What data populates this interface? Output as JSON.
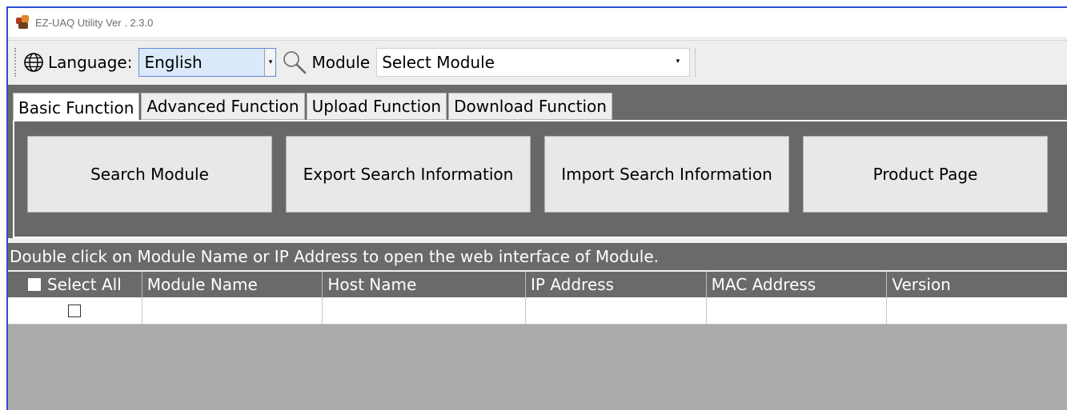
{
  "window": {
    "title": "EZ-UAQ Utility Ver . 2.3.0"
  },
  "toolbar": {
    "language_label": "Language:",
    "language_value": "English",
    "module_label": "Module",
    "module_value": "Select Module"
  },
  "tabs": [
    {
      "label": "Basic Function",
      "active": true
    },
    {
      "label": "Advanced Function",
      "active": false
    },
    {
      "label": "Upload Function",
      "active": false
    },
    {
      "label": "Download Function",
      "active": false
    }
  ],
  "buttons": {
    "search_module": "Search Module",
    "export_search": "Export Search Information",
    "import_search": "Import Search Information",
    "product_page": "Product Page"
  },
  "hint": "Double click on Module Name or IP Address to open the web interface of Module.",
  "table": {
    "columns": [
      "Select All",
      "Module Name",
      "Host Name",
      "IP Address",
      "MAC Address",
      "Version"
    ],
    "rows": [
      {
        "checked": false,
        "cells": [
          "",
          "",
          "",
          "",
          ""
        ]
      }
    ]
  },
  "colors": {
    "window_border": "#2d4fd6",
    "panel_dark": "#6a6a6a",
    "empty_area": "#ababab"
  },
  "icons": [
    "app-icon",
    "globe-icon",
    "search-icon",
    "chevron-down-icon",
    "checkbox-icon"
  ]
}
